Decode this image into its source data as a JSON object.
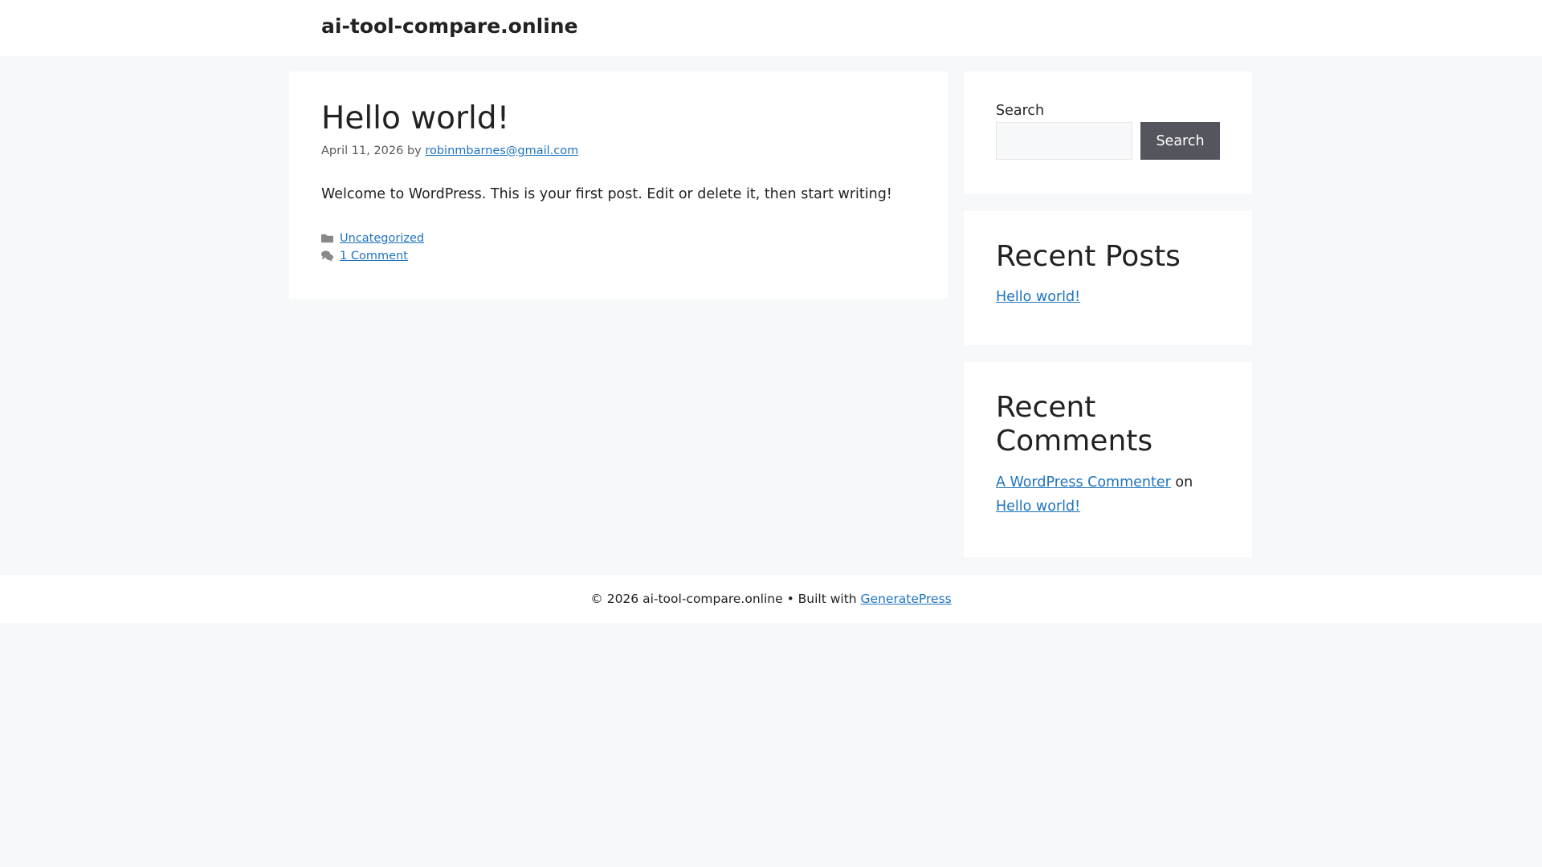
{
  "header": {
    "site_title": "ai-tool-compare.online"
  },
  "post": {
    "title": "Hello world!",
    "date": "April 11, 2026",
    "by": "by",
    "author": "robinmbarnes@gmail.com",
    "content": "Welcome to WordPress. This is your first post. Edit or delete it, then start writing!",
    "category": "Uncategorized",
    "comments": "1 Comment"
  },
  "sidebar": {
    "search": {
      "label": "Search",
      "value": "",
      "button": "Search"
    },
    "recent_posts": {
      "title": "Recent Posts",
      "items": [
        "Hello world!"
      ]
    },
    "recent_comments": {
      "title": "Recent Comments",
      "author": "A WordPress Commenter",
      "on": "on",
      "post": "Hello world!"
    }
  },
  "footer": {
    "copyright": "© 2026 ai-tool-compare.online • Built with",
    "link": "GeneratePress"
  }
}
